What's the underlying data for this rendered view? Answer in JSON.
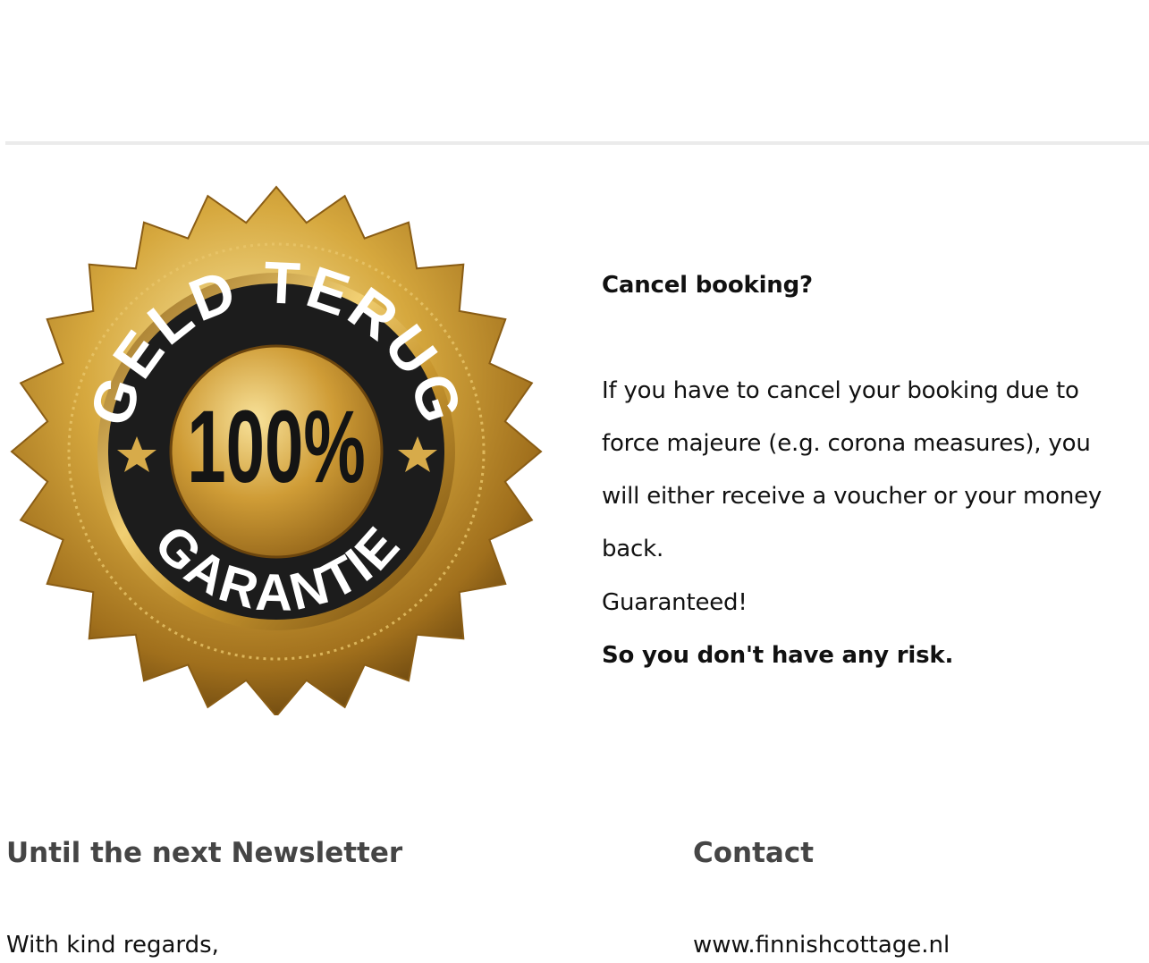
{
  "guarantee": {
    "badge": {
      "top_text": "GELD TERUG",
      "center_text": "100%",
      "bottom_text": "GARANTIE",
      "star_icon": "star-icon",
      "colors": {
        "gold": "#c8962e",
        "dark": "#1c1c1c",
        "highlight": "#f6dc8a"
      }
    },
    "heading": "Cancel booking?",
    "body_lines": [
      "If you have to cancel your booking due to",
      "force majeure (e.g. corona measures), you",
      "will either receive a voucher or your money",
      "back."
    ],
    "guaranteed": "Guaranteed!",
    "risk": "So you don't have any risk."
  },
  "footer": {
    "left": {
      "heading": "Until the next Newsletter",
      "text": "With kind regards,"
    },
    "right": {
      "heading": "Contact",
      "text": "www.finnishcottage.nl"
    }
  }
}
